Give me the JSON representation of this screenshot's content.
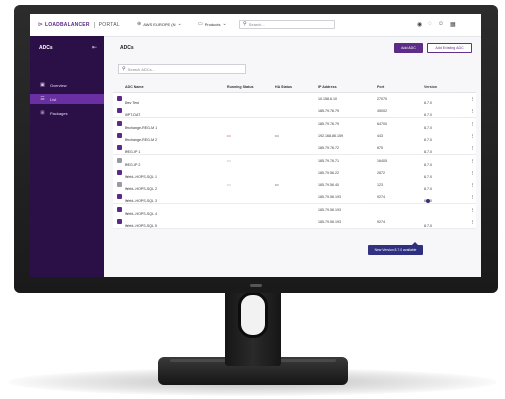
{
  "topbar": {
    "logo_text": "LOADBALANCER",
    "logo_portal": "PORTAL",
    "region_label": "AWS EUROPE (N",
    "products_label": "Products",
    "search_placeholder": "Search..."
  },
  "sidebar": {
    "title": "ADCs",
    "items": [
      {
        "label": "Overview",
        "icon": "grid-icon",
        "active": false
      },
      {
        "label": "List",
        "icon": "list-icon",
        "active": true
      },
      {
        "label": "Packages",
        "icon": "package-icon",
        "active": false
      }
    ]
  },
  "main": {
    "title": "ADCs",
    "add_button": "Add ADC",
    "add_existing_button": "Add Existing ADC",
    "search_placeholder": "Search ADCs...",
    "columns": [
      "ADC Name",
      "Running Status",
      "HA Status",
      "IP Address",
      "Port",
      "Version"
    ],
    "rows": [
      {
        "name": "Dev Test",
        "icon": "purple",
        "running": "",
        "ha": "",
        "ip": "10.158.6.10",
        "port": "27070",
        "version": "8.7.0"
      },
      {
        "name": "GPT-DAT",
        "icon": "purple",
        "running": "",
        "ha": "",
        "ip": "185.79.76.79",
        "port": "45002",
        "version": "8.7.0"
      },
      {
        "name": "Exchange-REG-M 1",
        "icon": "purple",
        "running": "",
        "ha": "",
        "ip": "185.79.76.79",
        "port": "64700",
        "version": "8.7.0"
      },
      {
        "name": "Exchange-REG-M 2",
        "icon": "purple",
        "running": "red",
        "ha": "•••",
        "ip": "192.168.86.159",
        "port": "443",
        "version": "8.7.0"
      },
      {
        "name": "REG-IP 1",
        "icon": "purple",
        "running": "",
        "ha": "",
        "ip": "185.79.76.72",
        "port": "875",
        "version": "8.7.0"
      },
      {
        "name": "REG-IP 2",
        "icon": "grey",
        "running": "grey",
        "ha": "",
        "ip": "185.79.76.71",
        "port": "16405",
        "version": "8.7.0"
      },
      {
        "name": "WebL-HOPS-SQL 1",
        "icon": "purple",
        "running": "",
        "ha": "",
        "ip": "185.79.56.22",
        "port": "2872",
        "version": "8.7.0"
      },
      {
        "name": "WebL-HOPS-SQL 2",
        "icon": "grey",
        "running": "grey",
        "ha": "•••",
        "ip": "185.79.56.40",
        "port": "123",
        "version": "8.7.0"
      },
      {
        "name": "WebL-HOPS-SQL 3",
        "icon": "purple",
        "running": "",
        "ha": "",
        "ip": "185.79.56.193",
        "port": "9274",
        "version": "8.6.0",
        "update": true
      },
      {
        "name": "WebL-HOPS-SQL 4",
        "icon": "purple",
        "running": "",
        "ha": "",
        "ip": "185.79.56.193",
        "port": "",
        "version": ""
      },
      {
        "name": "WebL-HOPS-SQL 5",
        "icon": "purple",
        "running": "",
        "ha": "",
        "ip": "185.79.56.193",
        "port": "9274",
        "version": "8.7.0"
      }
    ],
    "tooltip": "New Version 8.7.0 available"
  },
  "colors": {
    "sidebar_bg": "#2b1047",
    "sidebar_active": "#6a2fa3",
    "accent": "#5b2a86",
    "tooltip_bg": "#2f2f80"
  }
}
